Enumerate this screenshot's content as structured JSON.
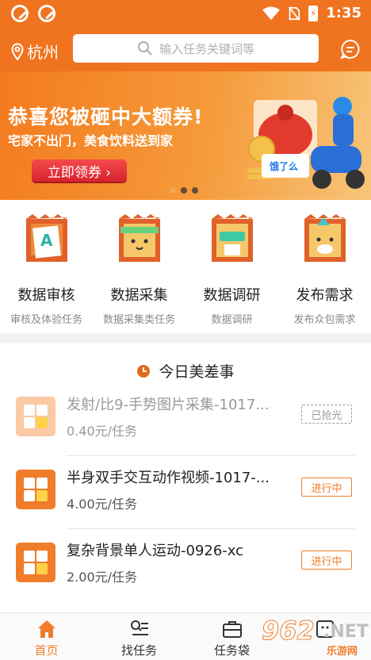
{
  "status_bar": {
    "time": "1:35"
  },
  "header": {
    "city": "杭州",
    "search_placeholder": "输入任务关键词等"
  },
  "banner": {
    "title": "恭喜您被砸中大额券!",
    "subtitle": "宅家不出门，美食饮料送到家",
    "button": "立即领券 ›",
    "art_text": "饿了么",
    "slides": 3,
    "active_slide": 0
  },
  "categories": [
    {
      "name": "数据审核",
      "desc": "审核及体验任务"
    },
    {
      "name": "数据采集",
      "desc": "数据采集类任务"
    },
    {
      "name": "数据调研",
      "desc": "数据调研"
    },
    {
      "name": "发布需求",
      "desc": "发布众包需求"
    }
  ],
  "tasks_section": {
    "title": "今日美差事",
    "items": [
      {
        "title": "发射/比9-手势图片采集-1017...",
        "price": "0.40元/任务",
        "status": "已抢光",
        "faded": true
      },
      {
        "title": "半身双手交互动作视频-1017-...",
        "price": "4.00元/任务",
        "status": "进行中",
        "faded": false
      },
      {
        "title": "复杂背景单人运动-0926-xc",
        "price": "2.00元/任务",
        "status": "进行中",
        "faded": false
      }
    ]
  },
  "tabbar": {
    "tabs": [
      {
        "label": "首页",
        "icon": "home-icon",
        "active": true
      },
      {
        "label": "找任务",
        "icon": "find-task-icon",
        "active": false
      },
      {
        "label": "任务袋",
        "icon": "task-bag-icon",
        "active": false
      },
      {
        "label": "",
        "icon": "profile-icon",
        "active": false
      }
    ]
  },
  "watermark": {
    "number": "962",
    "net": ".NET",
    "site": "乐游网"
  },
  "colors": {
    "brand": "#f07d2a",
    "header": "#f0731f",
    "badge_red": "#d8222e"
  }
}
